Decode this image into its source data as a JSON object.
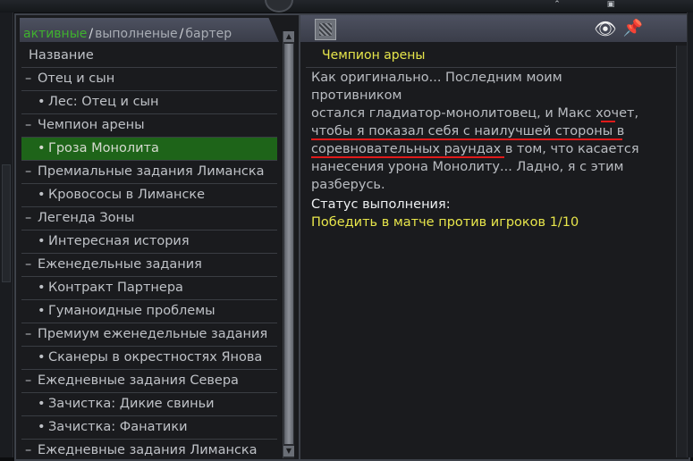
{
  "tabs": {
    "active": "активные",
    "completed": "выполненые",
    "barter": "бартер",
    "separator": "/"
  },
  "list": {
    "header": "Название",
    "rows": [
      {
        "kind": "group",
        "bullet": "–",
        "label": "Отец и сын"
      },
      {
        "kind": "child",
        "bullet": "•",
        "label": "Лес: Отец и сын"
      },
      {
        "kind": "group",
        "bullet": "–",
        "label": "Чемпион арены"
      },
      {
        "kind": "child",
        "bullet": "•",
        "label": "Гроза Монолита",
        "selected": true
      },
      {
        "kind": "group",
        "bullet": "–",
        "label": "Премиальные задания Лиманска"
      },
      {
        "kind": "child",
        "bullet": "•",
        "label": "Кровососы в Лиманске"
      },
      {
        "kind": "group",
        "bullet": "–",
        "label": "Легенда Зоны"
      },
      {
        "kind": "child",
        "bullet": "•",
        "label": "Интересная история"
      },
      {
        "kind": "group",
        "bullet": "–",
        "label": "Еженедельные задания"
      },
      {
        "kind": "child",
        "bullet": "•",
        "label": "Контракт Партнера"
      },
      {
        "kind": "child",
        "bullet": "•",
        "label": "Гуманоидные проблемы"
      },
      {
        "kind": "group",
        "bullet": "–",
        "label": "Премиум еженедельные задания"
      },
      {
        "kind": "child",
        "bullet": "•",
        "label": "Сканеры в окрестностях Янова"
      },
      {
        "kind": "group",
        "bullet": "–",
        "label": "Ежедневные задания Севера"
      },
      {
        "kind": "child",
        "bullet": "•",
        "label": "Зачистка: Дикие свиньи"
      },
      {
        "kind": "child",
        "bullet": "•",
        "label": "Зачистка: Фанатики"
      },
      {
        "kind": "group",
        "bullet": "–",
        "label": "Ежедневные задания Лиманска"
      }
    ]
  },
  "detail": {
    "quest_title": "Чемпион арены",
    "desc_lines": [
      "Как оригинально... Последним моим противником",
      "остался гладиатор-монолитовец, и Макс хочет,",
      "чтобы я показал себя с наилучшей стороны в",
      "соревновательных раундах в том, что касается",
      "нанесения урона Монолиту... Ладно, я с этим",
      "разберусь."
    ],
    "status_label": "Статус выполнения:",
    "status_value": "Победить в матче против игроков 1/10"
  },
  "icons": {
    "eye": "eye-icon",
    "pin": "pin-icon",
    "quest": "quest-icon"
  },
  "colors": {
    "active_tab": "#3fb12e",
    "selected_row": "#1e6419",
    "quest_title": "#e7e64b",
    "underline": "#e11a1a"
  }
}
